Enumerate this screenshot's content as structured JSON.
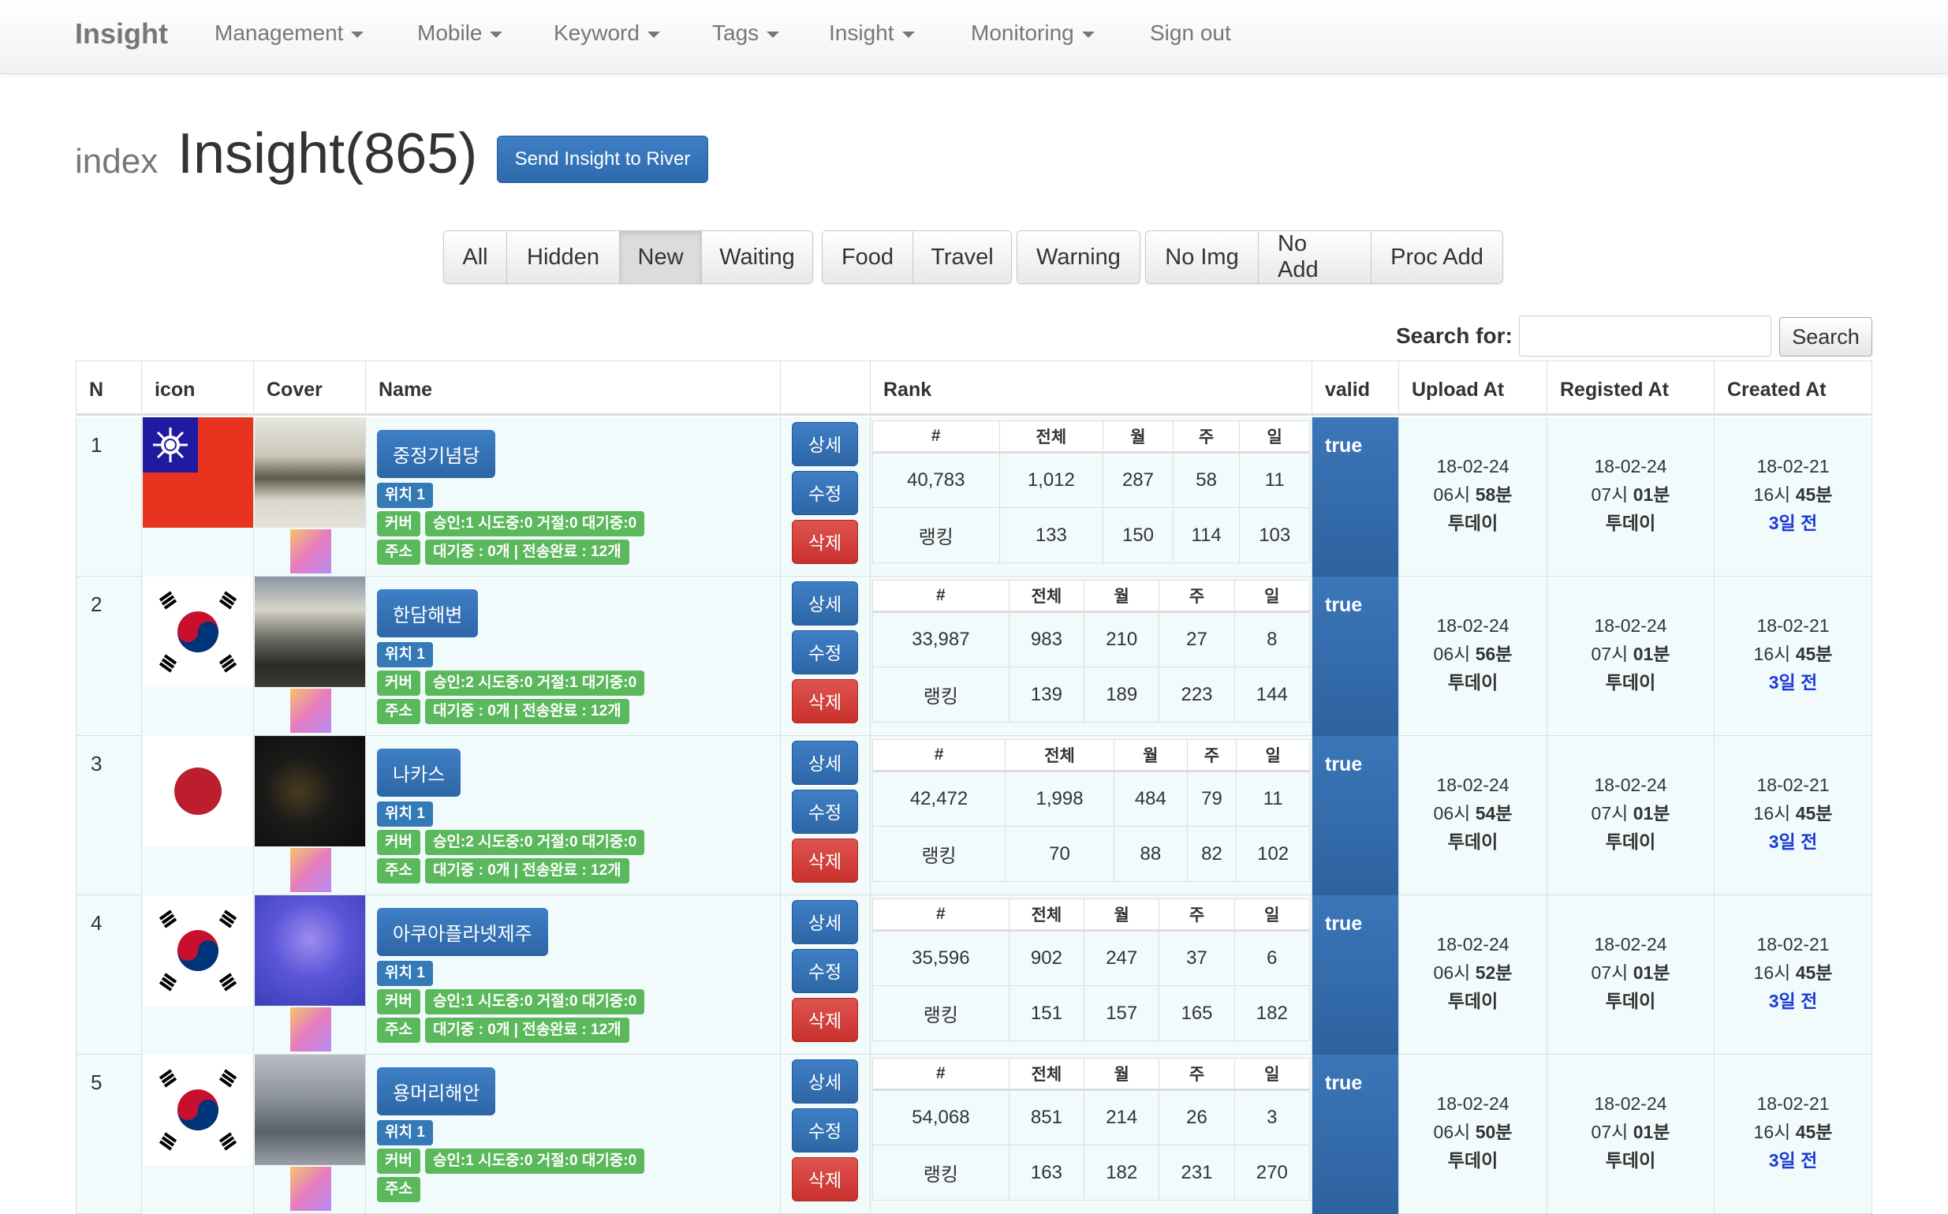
{
  "navbar": {
    "brand": "Insight",
    "items": [
      {
        "label": "Management",
        "dropdown": true
      },
      {
        "label": "Mobile",
        "dropdown": true
      },
      {
        "label": "Keyword",
        "dropdown": true
      },
      {
        "label": "Tags",
        "dropdown": true
      },
      {
        "label": "Insight",
        "dropdown": true
      },
      {
        "label": "Monitoring",
        "dropdown": true
      },
      {
        "label": "Sign out",
        "dropdown": false
      }
    ]
  },
  "header": {
    "small": "index",
    "title": "Insight(865)",
    "send_button": "Send Insight to River"
  },
  "filters": {
    "group1": [
      "All",
      "Hidden",
      "New",
      "Waiting"
    ],
    "group2": [
      "Food",
      "Travel"
    ],
    "group3": [
      "Warning"
    ],
    "group4": [
      "No Img",
      "No Add",
      "Proc Add"
    ],
    "active": "New"
  },
  "search": {
    "label": "Search for:",
    "value": "",
    "button": "Search"
  },
  "table": {
    "columns": [
      "N",
      "icon",
      "Cover",
      "Name",
      "",
      "Rank",
      "valid",
      "Upload At",
      "Registed At",
      "Created At"
    ],
    "rank_headers": [
      "#",
      "전체",
      "월",
      "주",
      "일"
    ],
    "rank_row_label": "랭킹",
    "action_labels": {
      "detail": "상세",
      "edit": "수정",
      "delete": "삭제"
    },
    "rows": [
      {
        "n": "1",
        "flag": "taiwan-flag-icon",
        "name": "중정기념당",
        "pos": "위치 1",
        "cover_tag": "커버",
        "cover_status": "승인:1 시도중:0 거절:0 대기중:0",
        "addr_tag": "주소",
        "addr_status": "대기중 : 0개 | 전송완료 : 12개",
        "counts": [
          "40,783",
          "1,012",
          "287",
          "58",
          "11"
        ],
        "ranks": [
          "133",
          "150",
          "114",
          "103"
        ],
        "valid": "true",
        "upload": {
          "date": "18-02-24",
          "hour": "06시",
          "min": "58분",
          "tag": "투데이"
        },
        "registed": {
          "date": "18-02-24",
          "hour": "07시",
          "min": "01분",
          "tag": "투데이"
        },
        "created": {
          "date": "18-02-21",
          "hour": "16시",
          "min": "45분",
          "tag": "3일 전"
        }
      },
      {
        "n": "2",
        "flag": "korea-flag-icon",
        "name": "한담해변",
        "pos": "위치 1",
        "cover_tag": "커버",
        "cover_status": "승인:2 시도중:0 거절:1 대기중:0",
        "addr_tag": "주소",
        "addr_status": "대기중 : 0개 | 전송완료 : 12개",
        "counts": [
          "33,987",
          "983",
          "210",
          "27",
          "8"
        ],
        "ranks": [
          "139",
          "189",
          "223",
          "144"
        ],
        "valid": "true",
        "upload": {
          "date": "18-02-24",
          "hour": "06시",
          "min": "56분",
          "tag": "투데이"
        },
        "registed": {
          "date": "18-02-24",
          "hour": "07시",
          "min": "01분",
          "tag": "투데이"
        },
        "created": {
          "date": "18-02-21",
          "hour": "16시",
          "min": "45분",
          "tag": "3일 전"
        }
      },
      {
        "n": "3",
        "flag": "japan-flag-icon",
        "name": "나카스",
        "pos": "위치 1",
        "cover_tag": "커버",
        "cover_status": "승인:2 시도중:0 거절:0 대기중:0",
        "addr_tag": "주소",
        "addr_status": "대기중 : 0개 | 전송완료 : 12개",
        "counts": [
          "42,472",
          "1,998",
          "484",
          "79",
          "11"
        ],
        "ranks": [
          "70",
          "88",
          "82",
          "102"
        ],
        "valid": "true",
        "upload": {
          "date": "18-02-24",
          "hour": "06시",
          "min": "54분",
          "tag": "투데이"
        },
        "registed": {
          "date": "18-02-24",
          "hour": "07시",
          "min": "01분",
          "tag": "투데이"
        },
        "created": {
          "date": "18-02-21",
          "hour": "16시",
          "min": "45분",
          "tag": "3일 전"
        }
      },
      {
        "n": "4",
        "flag": "korea-flag-icon",
        "name": "아쿠아플라넷제주",
        "pos": "위치 1",
        "cover_tag": "커버",
        "cover_status": "승인:1 시도중:0 거절:0 대기중:0",
        "addr_tag": "주소",
        "addr_status": "대기중 : 0개 | 전송완료 : 12개",
        "counts": [
          "35,596",
          "902",
          "247",
          "37",
          "6"
        ],
        "ranks": [
          "151",
          "157",
          "165",
          "182"
        ],
        "valid": "true",
        "upload": {
          "date": "18-02-24",
          "hour": "06시",
          "min": "52분",
          "tag": "투데이"
        },
        "registed": {
          "date": "18-02-24",
          "hour": "07시",
          "min": "01분",
          "tag": "투데이"
        },
        "created": {
          "date": "18-02-21",
          "hour": "16시",
          "min": "45분",
          "tag": "3일 전"
        }
      },
      {
        "n": "5",
        "flag": "korea-flag-icon",
        "name": "용머리해안",
        "pos": "위치 1",
        "cover_tag": "커버",
        "cover_status": "승인:1 시도중:0 거절:0 대기중:0",
        "addr_tag": "주소",
        "addr_status": "",
        "counts": [
          "54,068",
          "851",
          "214",
          "26",
          "3"
        ],
        "ranks": [
          "163",
          "182",
          "231",
          "270"
        ],
        "valid": "true",
        "upload": {
          "date": "18-02-24",
          "hour": "06시",
          "min": "50분",
          "tag": "투데이"
        },
        "registed": {
          "date": "18-02-24",
          "hour": "07시",
          "min": "01분",
          "tag": "투데이"
        },
        "created": {
          "date": "18-02-21",
          "hour": "16시",
          "min": "45분",
          "tag": "3일 전"
        }
      }
    ]
  },
  "colors": {
    "primary": "#337ab7",
    "danger": "#c9302c",
    "success": "#5cb85c",
    "row_bg": "#f1fbfb",
    "link": "#1a3ad8"
  }
}
